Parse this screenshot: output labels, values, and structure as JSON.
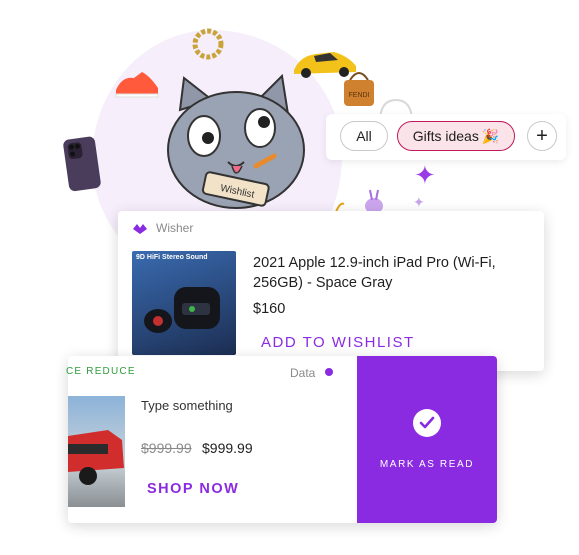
{
  "chips": {
    "all": "All",
    "gifts": "Gifts ideas",
    "gifts_emoji": "🎉",
    "add": "+"
  },
  "illustration": {
    "wishlist_sign": "Wishlist"
  },
  "wisher_card": {
    "source": "Wisher",
    "product_name": "2021 Apple 12.9-inch iPad Pro (Wi-Fi, 256GB) - Space Gray",
    "price": "$160",
    "add_button": "ADD TO WISHLIST",
    "thumb_caption": "9D HiFi Stereo Sound"
  },
  "deal_card": {
    "label": "CE REDUCE",
    "source": "Data",
    "description": "Type something",
    "old_price": "$999.99",
    "new_price": "$999.99",
    "shop_button": "SHOP NOW",
    "mark_button": "MARK AS READ"
  },
  "colors": {
    "accent": "#8a2be2",
    "chip_active_bg": "#fbe3ea",
    "chip_active_border": "#c2185b",
    "label_green": "#2e9d3c"
  }
}
